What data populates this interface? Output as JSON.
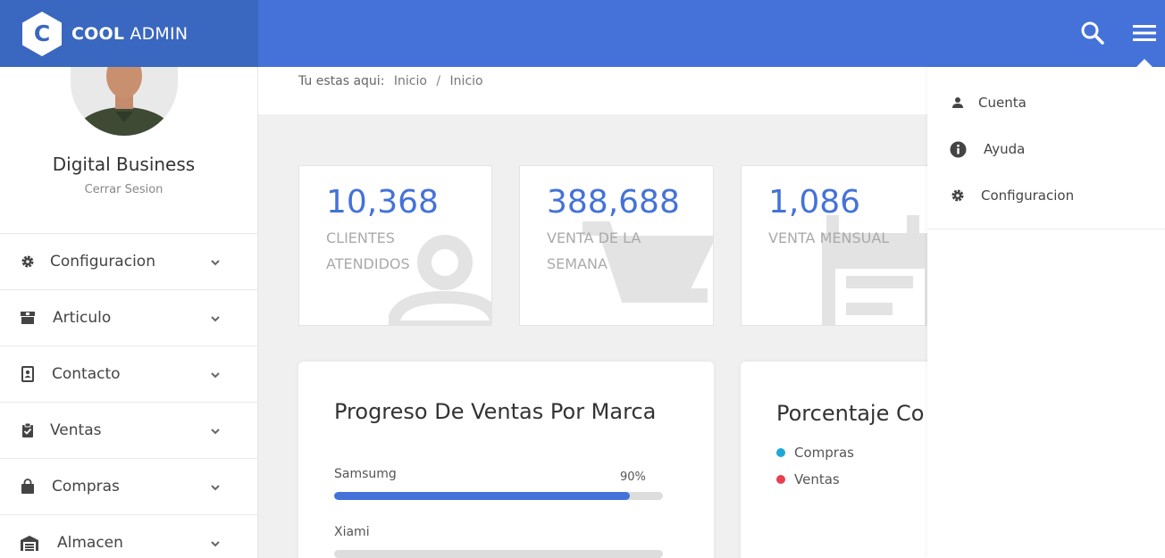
{
  "header": {
    "logo_letter": "C",
    "logo_bold": "COOL",
    "logo_light": "ADMIN",
    "bar_color": "#4472d9",
    "logo_bg_color": "#3a67bf",
    "icons": [
      "search-icon",
      "hamburger-menu-icon"
    ]
  },
  "profile": {
    "name": "Digital Business",
    "logout_label": "Cerrar Sesion"
  },
  "sidebar": {
    "items": [
      {
        "label": "Configuracion",
        "icon": "gear-icon"
      },
      {
        "label": "Articulo",
        "icon": "box-icon"
      },
      {
        "label": "Contacto",
        "icon": "contact-book-icon"
      },
      {
        "label": "Ventas",
        "icon": "clipboard-check-icon"
      },
      {
        "label": "Compras",
        "icon": "shopping-bag-icon"
      },
      {
        "label": "Almacen",
        "icon": "warehouse-icon"
      }
    ]
  },
  "breadcrumb": {
    "prefix": "Tu estas aqui:",
    "items": [
      "Inicio",
      "Inicio"
    ],
    "separator": "/"
  },
  "stats": [
    {
      "value": "10,368",
      "label": "CLIENTES ATENDIDOS",
      "icon": "user-icon"
    },
    {
      "value": "388,688",
      "label": "VENTA DE LA SEMANA",
      "icon": "cart-icon"
    },
    {
      "value": "1,086",
      "label": "VENTA MENSUAL",
      "icon": "calendar-icon"
    }
  ],
  "progress_card": {
    "title": "Progreso De Ventas Por Marca",
    "bars": [
      {
        "label": "Samsumg",
        "percent_label": "90%",
        "value": 0.9
      },
      {
        "label": "Xiami",
        "percent_label": "",
        "value": 0.0
      }
    ]
  },
  "percent_card": {
    "title": "Porcentaje Co",
    "legend": [
      {
        "label": "Compras",
        "color": "#1fa7d9"
      },
      {
        "label": "Ventas",
        "color": "#e8404f"
      }
    ]
  },
  "dropdown": {
    "items": [
      {
        "label": "Cuenta",
        "icon": "user-icon"
      },
      {
        "label": "Ayuda",
        "icon": "info-icon"
      },
      {
        "label": "Configuracion",
        "icon": "gear-icon"
      }
    ]
  }
}
